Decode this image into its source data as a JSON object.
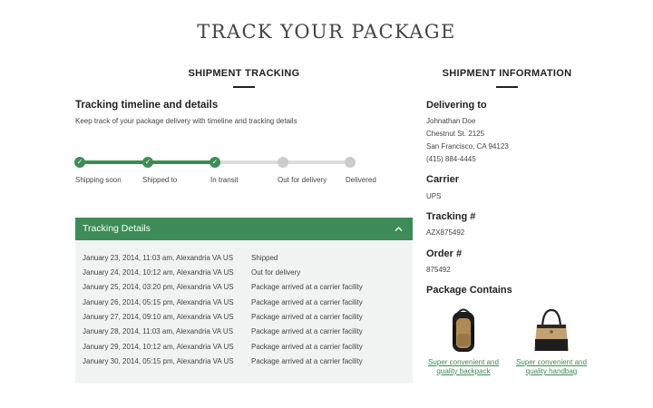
{
  "page": {
    "title": "TRACK YOUR PACKAGE"
  },
  "colors": {
    "accent": "#3d8c57",
    "panel": "#f1f2f2",
    "inactive": "#cccccc"
  },
  "shipment_tracking": {
    "heading": "SHIPMENT TRACKING",
    "timeline_title": "Tracking timeline and details",
    "timeline_subtitle": "Keep track of your package delivery with timeline and tracking details",
    "steps": [
      {
        "label": "Shipping soon",
        "done": true,
        "icon": "check-icon"
      },
      {
        "label": "Shipped to",
        "done": true,
        "icon": "check-icon"
      },
      {
        "label": "In transit",
        "done": true,
        "icon": "check-icon"
      },
      {
        "label": "Out for delivery",
        "done": false
      },
      {
        "label": "Delivered",
        "done": false
      }
    ],
    "progress": 0.5,
    "details": {
      "header": "Tracking Details",
      "toggle_icon": "chevron-up-icon",
      "rows": [
        {
          "date": "January 23, 2014, 11:03 am, Alexandria VA US",
          "status": "Shipped"
        },
        {
          "date": "January 24, 2014, 10:12 am, Alexandria VA US",
          "status": "Out for delivery"
        },
        {
          "date": "January 25, 2014, 03:20 pm, Alexandria VA US",
          "status": "Package arrived at a carrier facility"
        },
        {
          "date": "January 26, 2014, 05:15 pm, Alexandria VA US",
          "status": "Package arrived at a carrier facility"
        },
        {
          "date": "January 27, 2014, 09:10 am, Alexandria VA US",
          "status": "Package arrived at a carrier facility"
        },
        {
          "date": "January 28, 2014, 11:03 am, Alexandria VA US",
          "status": "Package arrived at a carrier facility"
        },
        {
          "date": "January 29, 2014, 10:12 am, Alexandria VA US",
          "status": "Package arrived at a carrier facility"
        },
        {
          "date": "January 30, 2014, 05:15 pm, Alexandria VA US",
          "status": "Package arrived at a carrier facility"
        }
      ]
    }
  },
  "shipment_information": {
    "heading": "SHIPMENT INFORMATION",
    "delivering_to": {
      "label": "Delivering to",
      "name": "Johnathan Doe",
      "street": "Chestnut St. 2125",
      "city": "San Francisco, CA 94123",
      "phone": "(415) 884-4445"
    },
    "carrier": {
      "label": "Carrier",
      "value": "UPS"
    },
    "tracking": {
      "label": "Tracking #",
      "value": "AZX875492"
    },
    "order": {
      "label": "Order #",
      "value": "875492"
    },
    "contents": {
      "label": "Package Contains",
      "items": [
        {
          "name_line1": "Super convenient and",
          "name_line2": "quality backpack",
          "icon": "backpack-image"
        },
        {
          "name_line1": "Super convenient and",
          "name_line2": "quality handbag",
          "icon": "handbag-image"
        }
      ]
    }
  }
}
